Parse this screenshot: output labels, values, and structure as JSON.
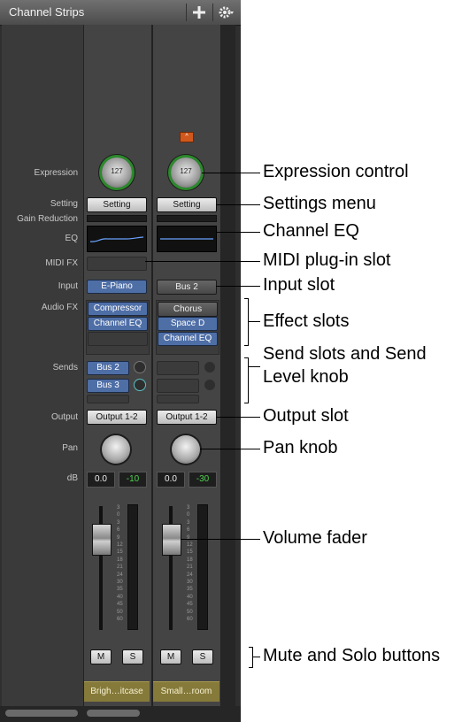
{
  "window": {
    "title": "Channel Strips",
    "add_icon": "plus-icon",
    "gear_icon": "gear-icon"
  },
  "row_labels": {
    "expression": "Expression",
    "setting": "Setting",
    "gain_reduction": "Gain Reduction",
    "eq": "EQ",
    "midi_fx": "MIDI FX",
    "input": "Input",
    "audio_fx": "Audio FX",
    "sends": "Sends",
    "output": "Output",
    "pan": "Pan",
    "db": "dB"
  },
  "strips": [
    {
      "expression_value": "127",
      "setting": "Setting",
      "input": "E-Piano",
      "audio_fx": [
        "Compressor",
        "Channel EQ"
      ],
      "sends": [
        "Bus 2",
        "Bus 3"
      ],
      "output": "Output 1-2",
      "volume_db": "0.0",
      "peak_db": "-10",
      "mute": "M",
      "solo": "S",
      "name": "Brigh…itcase"
    },
    {
      "expression_value": "127",
      "setting": "Setting",
      "input": "Bus 2",
      "audio_fx": [
        "Chorus",
        "Space D",
        "Channel EQ"
      ],
      "sends": [],
      "output": "Output 1-2",
      "volume_db": "0.0",
      "peak_db": "-30",
      "mute": "M",
      "solo": "S",
      "name": "Small…room",
      "badge": "^"
    }
  ],
  "meter_scale": [
    "3",
    "0",
    "3",
    "6",
    "9",
    "12",
    "15",
    "18",
    "21",
    "24",
    "30",
    "35",
    "40",
    "45",
    "50",
    "60"
  ],
  "callouts": {
    "expression": "Expression control",
    "settings": "Settings menu",
    "eq": "Channel EQ",
    "midi": "MIDI plug-in slot",
    "input": "Input slot",
    "effects": "Effect slots",
    "sends_1": "Send slots and Send",
    "sends_2": "Level knob",
    "output": "Output slot",
    "pan": "Pan knob",
    "volume": "Volume fader",
    "mute_solo": "Mute and Solo buttons"
  }
}
